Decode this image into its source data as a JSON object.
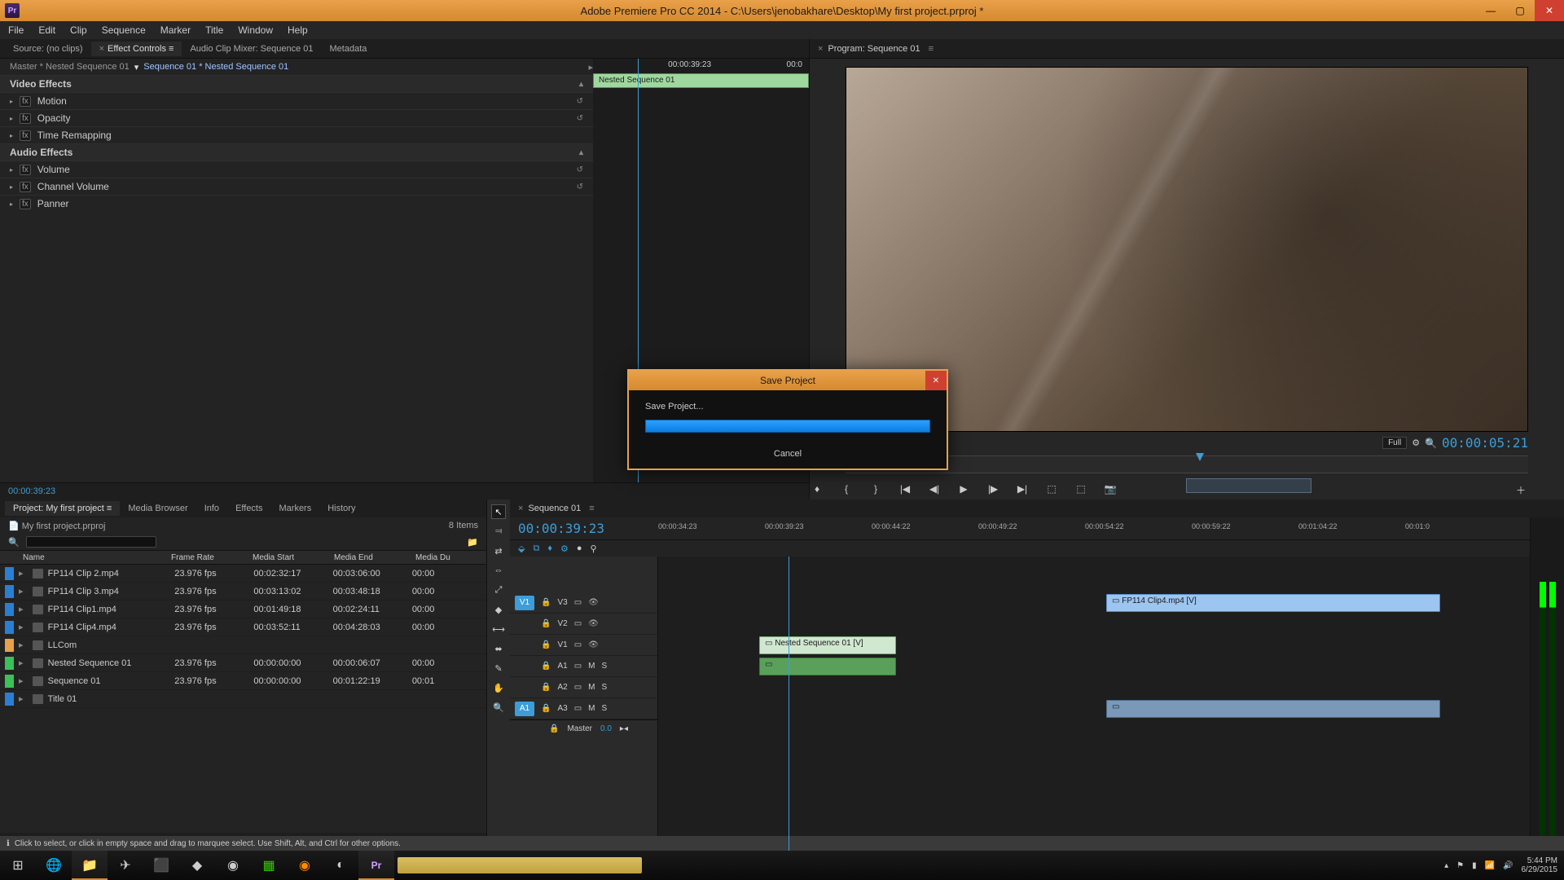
{
  "app": {
    "title": "Adobe Premiere Pro CC 2014 - C:\\Users\\jenobakhare\\Desktop\\My first project.prproj *",
    "icon_label": "Pr"
  },
  "menu": [
    "File",
    "Edit",
    "Clip",
    "Sequence",
    "Marker",
    "Title",
    "Window",
    "Help"
  ],
  "source_tabs": [
    {
      "label": "Source: (no clips)",
      "active": false
    },
    {
      "label": "Effect Controls",
      "active": true
    },
    {
      "label": "Audio Clip Mixer: Sequence 01",
      "active": false
    },
    {
      "label": "Metadata",
      "active": false
    }
  ],
  "effect_controls": {
    "breadcrumb_inactive": "Master * Nested Sequence 01",
    "breadcrumb": "Sequence 01 * Nested Sequence 01",
    "mini_tc_left": "00:00:39:23",
    "mini_tc_right": "00:0",
    "clip_label": "Nested Sequence 01",
    "video_header": "Video Effects",
    "audio_header": "Audio Effects",
    "video": [
      "Motion",
      "Opacity",
      "Time Remapping"
    ],
    "audio": [
      "Volume",
      "Channel Volume",
      "Panner"
    ],
    "lower_tc": "00:00:39:23"
  },
  "program": {
    "title": "Program: Sequence 01",
    "resolution": "Full",
    "right_tc": "00:00:05:21"
  },
  "project_panel": {
    "tabs": [
      "Project: My first project",
      "Media Browser",
      "Info",
      "Effects",
      "Markers",
      "History"
    ],
    "file_label": "My first project.prproj",
    "item_count": "8 Items",
    "columns": [
      "Name",
      "Frame Rate",
      "Media Start",
      "Media End",
      "Media Du"
    ],
    "rows": [
      {
        "color": "#2a7fd4",
        "name": "FP114 Clip 2.mp4",
        "fr": "23.976 fps",
        "ms": "00:02:32:17",
        "me": "00:03:06:00",
        "md": "00:00"
      },
      {
        "color": "#2a7fd4",
        "name": "FP114 Clip 3.mp4",
        "fr": "23.976 fps",
        "ms": "00:03:13:02",
        "me": "00:03:48:18",
        "md": "00:00"
      },
      {
        "color": "#2a7fd4",
        "name": "FP114 Clip1.mp4",
        "fr": "23.976 fps",
        "ms": "00:01:49:18",
        "me": "00:02:24:11",
        "md": "00:00"
      },
      {
        "color": "#2a7fd4",
        "name": "FP114 Clip4.mp4",
        "fr": "23.976 fps",
        "ms": "00:03:52:11",
        "me": "00:04:28:03",
        "md": "00:00"
      },
      {
        "color": "#e8a04a",
        "name": "LLCom",
        "fr": "",
        "ms": "",
        "me": "",
        "md": ""
      },
      {
        "color": "#3cc05a",
        "name": "Nested Sequence 01",
        "fr": "23.976 fps",
        "ms": "00:00:00:00",
        "me": "00:00:06:07",
        "md": "00:00"
      },
      {
        "color": "#3cc05a",
        "name": "Sequence 01",
        "fr": "23.976 fps",
        "ms": "00:00:00:00",
        "me": "00:01:22:19",
        "md": "00:01"
      },
      {
        "color": "#2a7fd4",
        "name": "Title 01",
        "fr": "",
        "ms": "",
        "me": "",
        "md": ""
      }
    ]
  },
  "timeline": {
    "tab": "Sequence 01",
    "tc": "00:00:39:23",
    "ruler": [
      "00:00:34:23",
      "00:00:39:23",
      "00:00:44:22",
      "00:00:49:22",
      "00:00:54:22",
      "00:00:59:22",
      "00:01:04:22",
      "00:01:0"
    ],
    "videotracks": [
      {
        "tag": "V1",
        "label": "V3",
        "active": true
      },
      {
        "tag": "",
        "label": "V2",
        "active": false
      },
      {
        "tag": "",
        "label": "V1",
        "active": false
      }
    ],
    "audiotracks": [
      {
        "tag": "",
        "label": "A1",
        "active": false
      },
      {
        "tag": "",
        "label": "A2",
        "active": false
      },
      {
        "tag": "A1",
        "label": "A3",
        "active": true
      }
    ],
    "master": {
      "label": "Master",
      "value": "0.0"
    },
    "clips": {
      "nested_v": "Nested Sequence 01 [V]",
      "fp4": "FP114 Clip4.mp4 [V]"
    },
    "meter_labels": [
      "S",
      "S"
    ]
  },
  "hint": "Click to select, or click in empty space and drag to marquee select. Use Shift, Alt, and Ctrl for other options.",
  "taskbar": {
    "time": "5:44 PM",
    "date": "6/29/2015"
  },
  "dialog": {
    "title": "Save Project",
    "label": "Save Project...",
    "cancel": "Cancel"
  }
}
